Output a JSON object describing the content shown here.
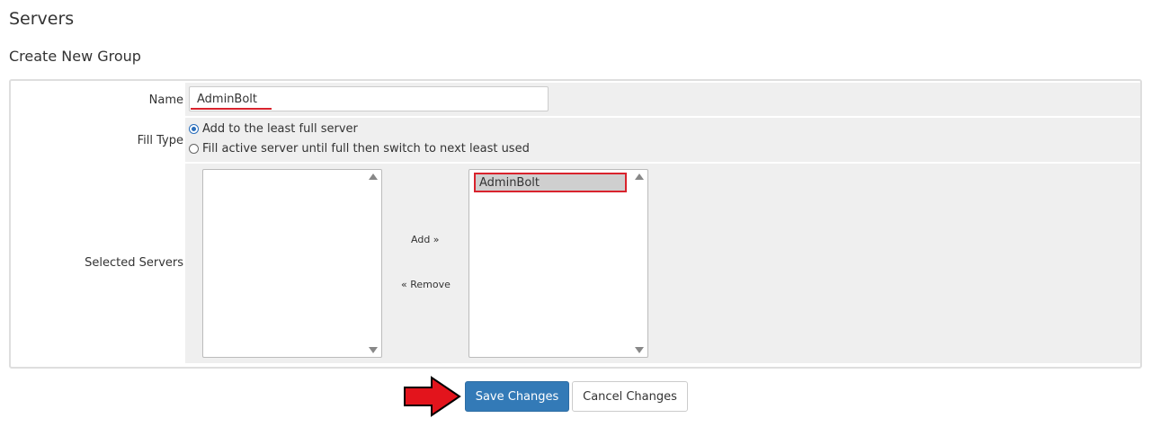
{
  "header": {
    "title": "Servers",
    "subtitle": "Create New Group"
  },
  "form": {
    "name": {
      "label": "Name",
      "value": "AdminBolt"
    },
    "fill_type": {
      "label": "Fill Type",
      "options": [
        {
          "label": "Add to the least full server",
          "checked": true
        },
        {
          "label": "Fill active server until full then switch to next least used",
          "checked": false
        }
      ]
    },
    "selected_servers": {
      "label": "Selected Servers",
      "available": [],
      "selected": [
        "AdminBolt"
      ],
      "add_label": "Add »",
      "remove_label": "« Remove"
    }
  },
  "actions": {
    "save_label": "Save Changes",
    "cancel_label": "Cancel Changes"
  },
  "colors": {
    "primary": "#337ab7",
    "highlight_annotation": "#d9232d"
  }
}
